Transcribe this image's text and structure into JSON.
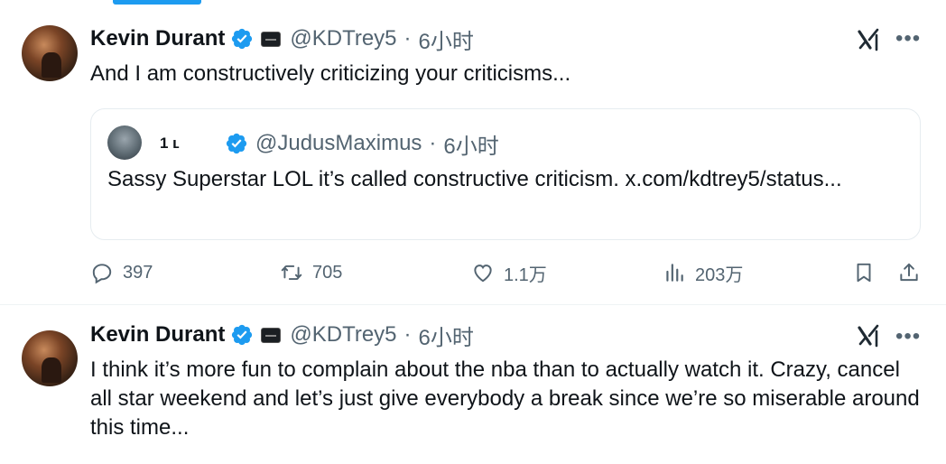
{
  "tweets": [
    {
      "author_name": "Kevin Durant",
      "handle": "@KDTrey5",
      "separator": "·",
      "time": "6小时",
      "text": "And I am constructively criticizing your criticisms...",
      "quote": {
        "author_name": "1 ʟ",
        "handle": "@JudusMaximus",
        "separator": "·",
        "time": "6小时",
        "text": "Sassy Superstar LOL it’s called constructive criticism. x.com/kdtrey5/status..."
      },
      "stats": {
        "replies": "397",
        "retweets": "705",
        "likes": "1.1万",
        "views": "203万"
      }
    },
    {
      "author_name": "Kevin Durant",
      "handle": "@KDTrey5",
      "separator": "·",
      "time": "6小时",
      "text": "I think it’s more fun to complain about the nba than to actually watch it. Crazy, cancel all star weekend and let’s just give everybody a break since we’re so miserable around this time..."
    }
  ],
  "icons": {
    "verified": "verified-badge-icon",
    "affiliation": "affiliation-badge-icon",
    "grok": "grok-icon",
    "more": "more-icon",
    "reply": "reply-icon",
    "retweet": "retweet-icon",
    "like": "like-icon",
    "views": "views-icon",
    "bookmark": "bookmark-icon",
    "share": "share-icon"
  },
  "colors": {
    "accent": "#1d9bf0",
    "text": "#0f1419",
    "secondary": "#536471",
    "border": "#e6ecf0"
  }
}
